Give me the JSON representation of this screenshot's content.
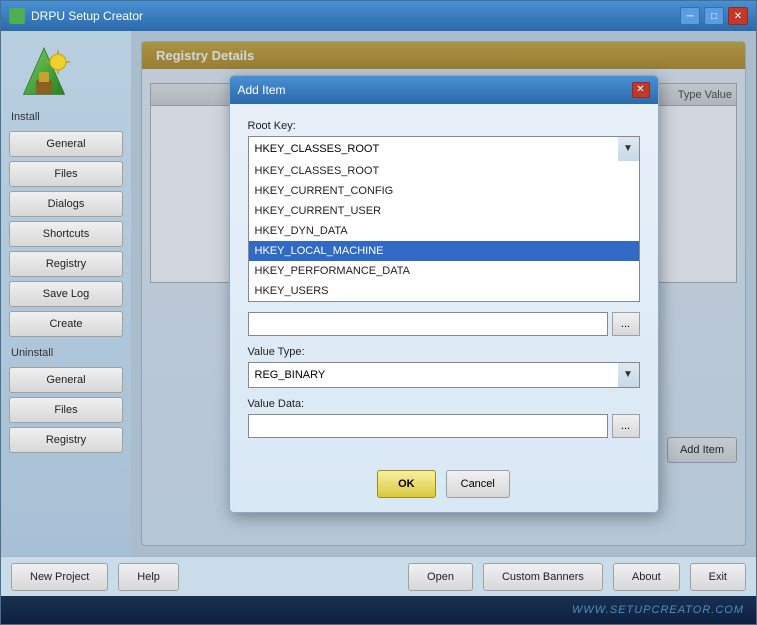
{
  "titlebar": {
    "title": "DRPU Setup Creator",
    "minimize_label": "─",
    "maximize_label": "□",
    "close_label": "✕"
  },
  "sidebar": {
    "install_label": "Install",
    "uninstall_label": "Uninstall",
    "buttons_install": [
      "General",
      "Files",
      "Dialogs",
      "Shortcuts",
      "Registry",
      "Save Log",
      "Create"
    ],
    "buttons_uninstall": [
      "General",
      "Files",
      "Registry"
    ]
  },
  "registry_panel": {
    "title": "Registry Details",
    "table_col": "Type Value"
  },
  "footer_buttons": {
    "new_project": "New Project",
    "help": "Help",
    "open": "Open",
    "custom_banners": "Custom Banners",
    "about": "About",
    "exit": "Exit"
  },
  "watermark": "WWW.SETUPCREATOR.COM",
  "dialog": {
    "title": "Add Item",
    "close_label": "✕",
    "root_key_label": "Root Key:",
    "root_key_value": "HKEY_CLASSES_ROOT",
    "root_key_options": [
      "HKEY_CLASSES_ROOT",
      "HKEY_CURRENT_CONFIG",
      "HKEY_CURRENT_USER",
      "HKEY_DYN_DATA",
      "HKEY_LOCAL_MACHINE",
      "HKEY_PERFORMANCE_DATA",
      "HKEY_USERS"
    ],
    "selected_option": "HKEY_LOCAL_MACHINE",
    "browse_label": "...",
    "browse2_label": "...",
    "value_type_label": "Value Type:",
    "value_type_value": "REG_BINARY",
    "value_data_label": "Value Data:",
    "value_data_placeholder": "",
    "browse3_label": "...",
    "ok_label": "OK",
    "cancel_label": "Cancel"
  },
  "add_item_btn": "Add Item"
}
